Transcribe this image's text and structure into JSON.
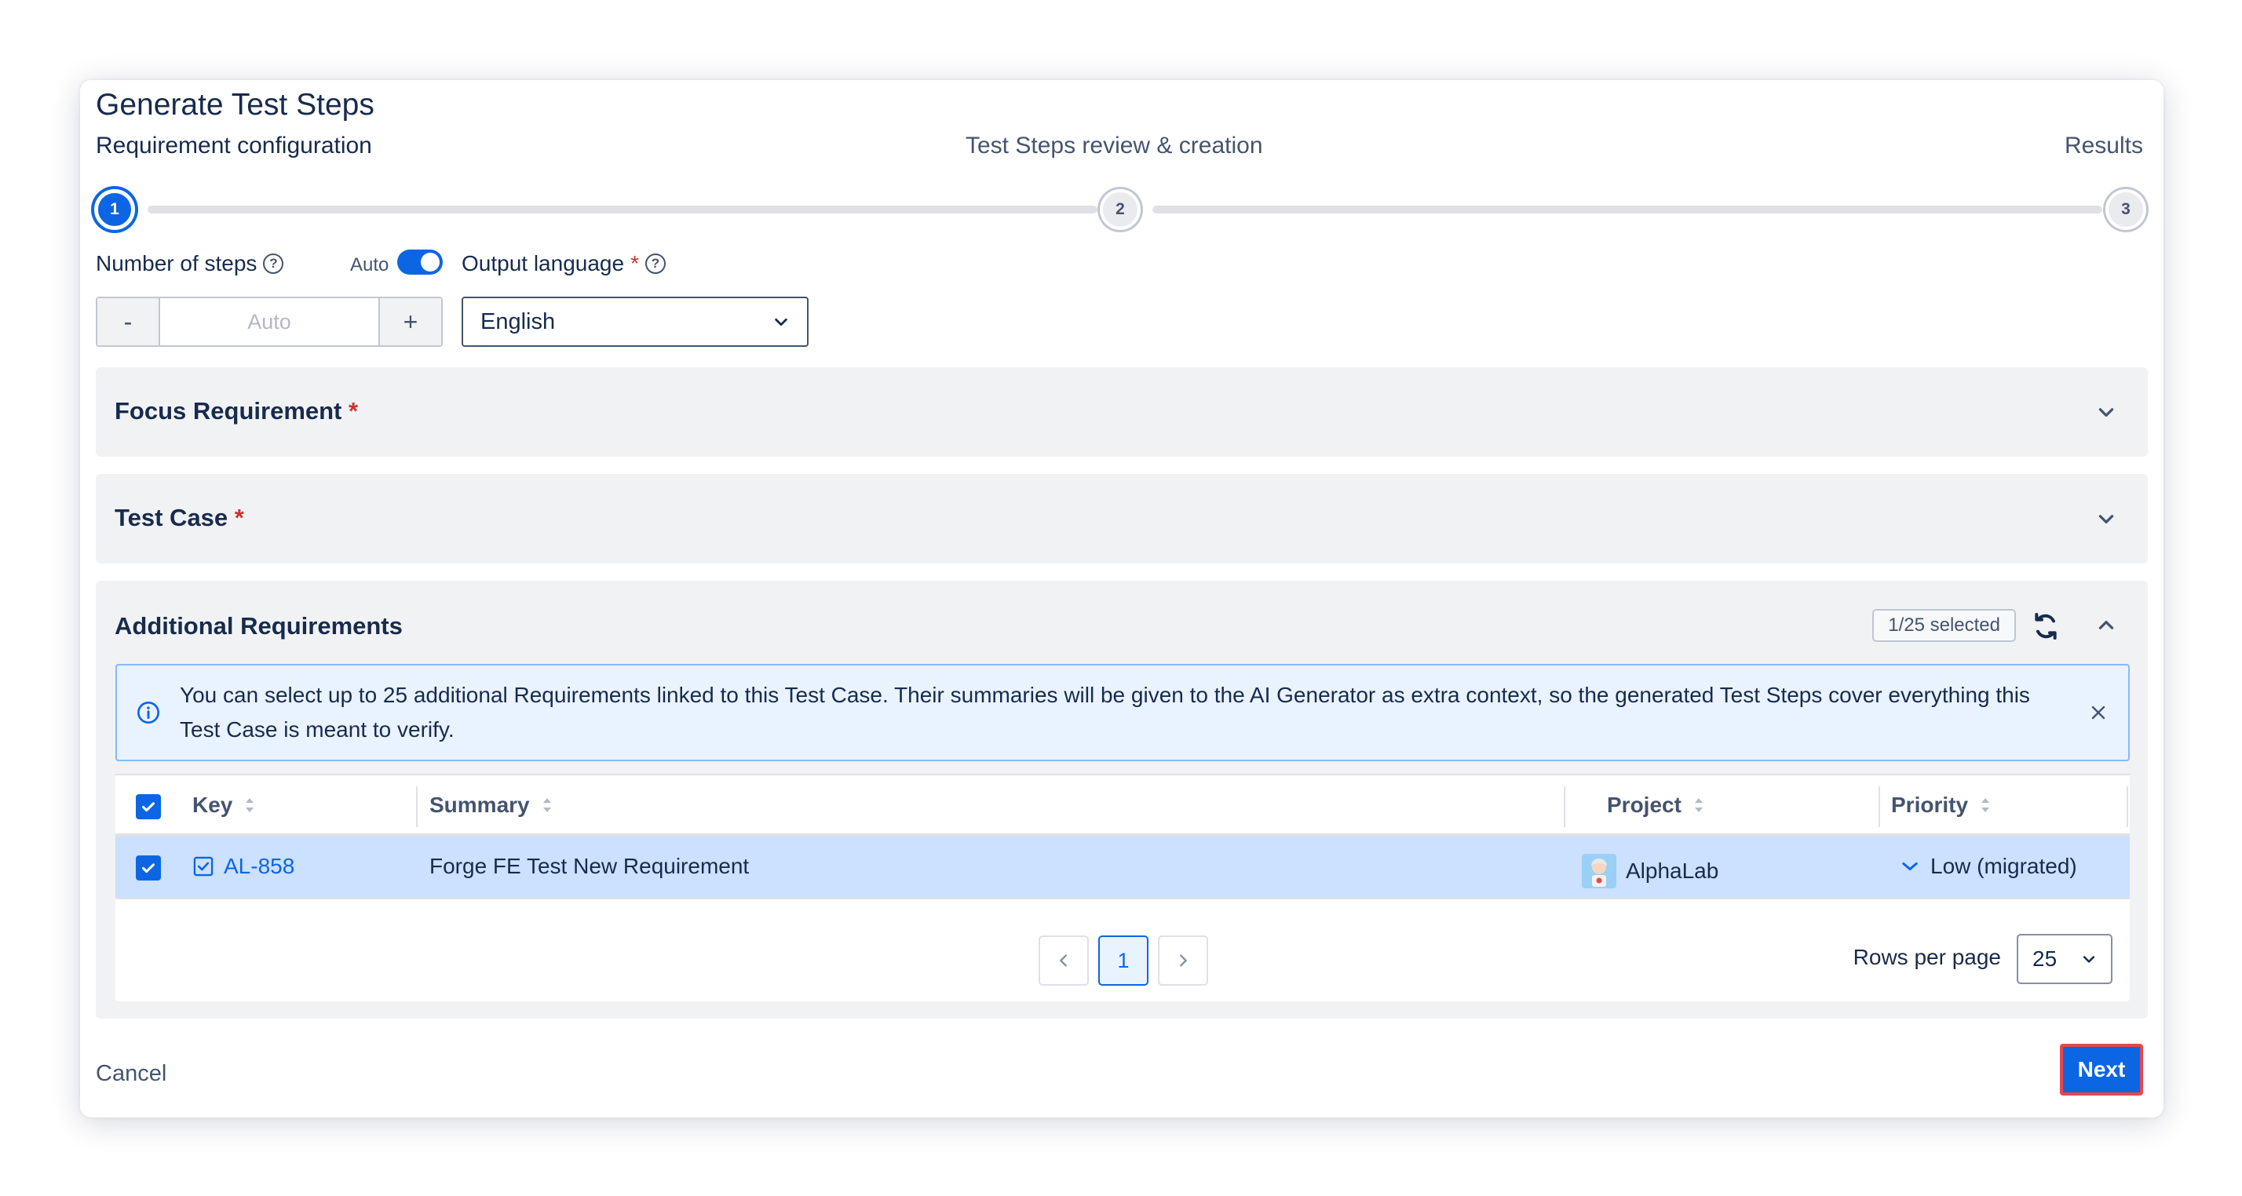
{
  "dialog": {
    "title": "Generate Test Steps"
  },
  "stepper": {
    "steps": [
      {
        "number": "1",
        "label": "Requirement configuration",
        "active": true
      },
      {
        "number": "2",
        "label": "Test Steps review & creation",
        "active": false
      },
      {
        "number": "3",
        "label": "Results",
        "active": false
      }
    ]
  },
  "config": {
    "steps_label": "Number of steps",
    "auto_label": "Auto",
    "auto_enabled": true,
    "minus": "-",
    "plus": "+",
    "steps_placeholder": "Auto",
    "language_label": "Output language",
    "language_value": "English",
    "required_mark": "*",
    "help_glyph": "?"
  },
  "sections": {
    "focus": {
      "title": "Focus Requirement",
      "expanded": false
    },
    "test_case": {
      "title": "Test Case",
      "expanded": false
    },
    "additional": {
      "title": "Additional Requirements",
      "expanded": true,
      "selected_badge": "1/25 selected",
      "info_text": "You can select up to 25 additional Requirements linked to this Test Case. Their summaries will be given to the AI Generator as extra context, so the generated Test Steps cover everything this Test Case is meant to verify."
    }
  },
  "table": {
    "columns": [
      "Key",
      "Summary",
      "Project",
      "Priority"
    ],
    "rows": [
      {
        "key": "AL-858",
        "summary": "Forge FE Test New Requirement",
        "project": "AlphaLab",
        "priority": "Low (migrated)",
        "selected": true
      }
    ]
  },
  "pagination": {
    "current_page": "1",
    "rows_per_page_label": "Rows per page",
    "rows_per_page_value": "25"
  },
  "footer": {
    "cancel_label": "Cancel",
    "next_label": "Next"
  },
  "colors": {
    "accent": "#0c66e4",
    "selected_row": "#cce0ff",
    "info_bg": "#e9f2ff",
    "highlight_border": "#e5484d"
  }
}
